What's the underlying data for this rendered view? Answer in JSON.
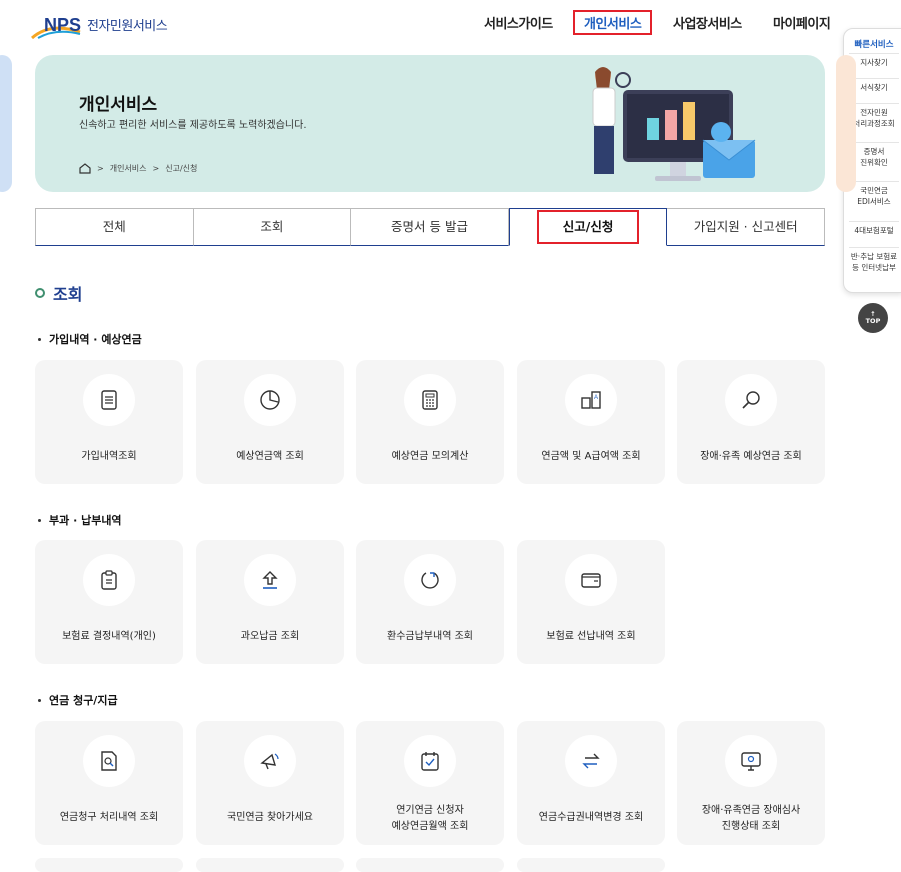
{
  "header": {
    "logo": "NPS",
    "site_name": "전자민원서비스",
    "nav": [
      "서비스가이드",
      "개인서비스",
      "사업장서비스",
      "마이페이지"
    ],
    "active_nav_index": 1
  },
  "quick": {
    "title": "빠른서비스",
    "items": [
      "지사찾기",
      "서식찾기",
      "전자민원\n처리과정조회",
      "증명서\n진위확인",
      "국민연금\nEDI서비스",
      "4대보험포털",
      "반·추납 보험료\n등 인터넷납부"
    ],
    "top_label": "TOP"
  },
  "banner": {
    "title": "개인서비스",
    "subtitle": "신속하고 편리한 서비스를 제공하도록 노력하겠습니다.",
    "breadcrumb": [
      "개인서비스",
      "신고/신청"
    ]
  },
  "tabs": [
    "전체",
    "조회",
    "증명서 등 발급",
    "신고/신청",
    "가입지원 · 신고센터"
  ],
  "active_tab_index": 3,
  "section": {
    "title": "조회",
    "groups": [
      {
        "title": "가입내역 · 예상연금",
        "items": [
          "가입내역조회",
          "예상연금액 조회",
          "예상연금 모의계산",
          "연금액 및 A급여액 조회",
          "장애·유족 예상연금 조회"
        ],
        "icons": [
          "document-icon",
          "pie-chart-icon",
          "calculator-icon",
          "a-value-icon",
          "search-icon"
        ]
      },
      {
        "title": "부과 · 납부내역",
        "items": [
          "보험료 결정내역(개인)",
          "과오납금 조회",
          "환수금납부내역 조회",
          "보험료 선납내역 조회"
        ],
        "icons": [
          "clipboard-icon",
          "upload-icon",
          "refresh-icon",
          "wallet-icon"
        ]
      },
      {
        "title": "연금 청구/지급",
        "items": [
          "연금청구 처리내역 조회",
          "국민연금 찾아가세요",
          "연기연금 신청자\n예상연금월액 조회",
          "연금수급권내역변경 조회",
          "장애·유족연금 장애심사\n진행상태 조회"
        ],
        "icons": [
          "document-search-icon",
          "megaphone-icon",
          "calendar-check-icon",
          "exchange-icon",
          "monitor-search-icon"
        ]
      }
    ]
  },
  "colors": {
    "brand": "#1f3f8f",
    "banner_bg": "#d3ebe7",
    "highlight": "#e3212b",
    "card_bg": "#f5f5f5"
  }
}
